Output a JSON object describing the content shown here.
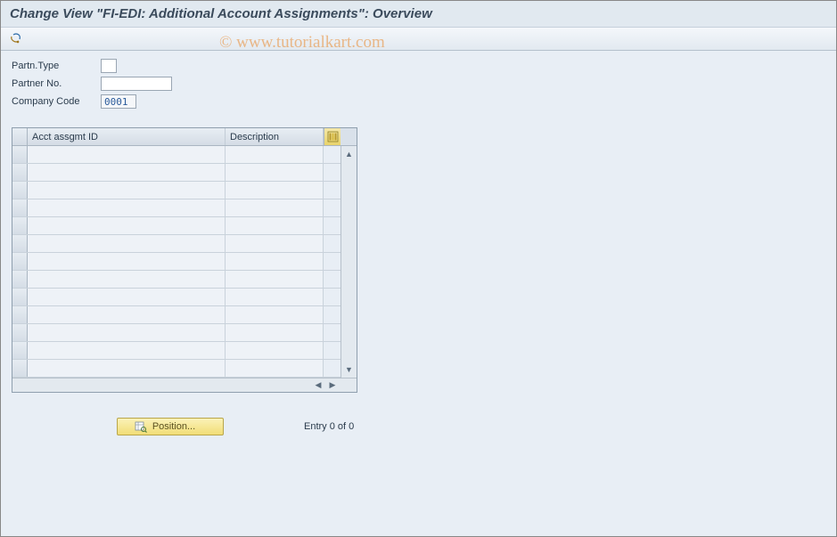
{
  "title": "Change View \"FI-EDI: Additional Account Assignments\": Overview",
  "watermark": "© www.tutorialkart.com",
  "fields": {
    "partn_type": {
      "label": "Partn.Type",
      "value": ""
    },
    "partner_no": {
      "label": "Partner No.",
      "value": ""
    },
    "company_code": {
      "label": "Company Code",
      "value": "0001"
    }
  },
  "table": {
    "columns": {
      "id": "Acct assgmt ID",
      "desc": "Description"
    },
    "rows": [
      {
        "id": "",
        "desc": ""
      },
      {
        "id": "",
        "desc": ""
      },
      {
        "id": "",
        "desc": ""
      },
      {
        "id": "",
        "desc": ""
      },
      {
        "id": "",
        "desc": ""
      },
      {
        "id": "",
        "desc": ""
      },
      {
        "id": "",
        "desc": ""
      },
      {
        "id": "",
        "desc": ""
      },
      {
        "id": "",
        "desc": ""
      },
      {
        "id": "",
        "desc": ""
      },
      {
        "id": "",
        "desc": ""
      },
      {
        "id": "",
        "desc": ""
      },
      {
        "id": "",
        "desc": ""
      }
    ]
  },
  "footer": {
    "position_label": "Position...",
    "entry_text": "Entry 0 of 0"
  }
}
